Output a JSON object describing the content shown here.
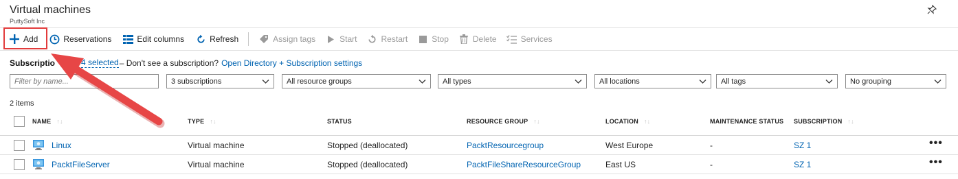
{
  "header": {
    "title": "Virtual machines",
    "subtitle": "PuttySoft Inc"
  },
  "toolbar": {
    "add": "Add",
    "reservations": "Reservations",
    "edit_columns": "Edit columns",
    "refresh": "Refresh",
    "assign_tags": "Assign tags",
    "start": "Start",
    "restart": "Restart",
    "stop": "Stop",
    "delete": "Delete",
    "services": "Services"
  },
  "subscription_line": {
    "label": "Subscriptio",
    "selected": "4 selected",
    "text": " – Don't see a subscription?",
    "link": "Open Directory + Subscription settings"
  },
  "filters": {
    "name_placeholder": "Filter by name...",
    "subscriptions": "3 subscriptions",
    "resource_groups": "All resource groups",
    "types": "All types",
    "locations": "All locations",
    "tags": "All tags",
    "grouping": "No grouping"
  },
  "items_count": "2 items",
  "columns": {
    "name": "NAME",
    "type": "TYPE",
    "status": "STATUS",
    "resource_group": "RESOURCE GROUP",
    "location": "LOCATION",
    "maintenance": "MAINTENANCE STATUS",
    "subscription": "SUBSCRIPTION"
  },
  "rows": [
    {
      "name": "Linux",
      "type": "Virtual machine",
      "status": "Stopped (deallocated)",
      "resource_group": "PacktResourcegroup",
      "location": "West Europe",
      "maintenance": "-",
      "subscription": "SZ 1",
      "more": "•••"
    },
    {
      "name": "PacktFileServer",
      "type": "Virtual machine",
      "status": "Stopped (deallocated)",
      "resource_group": "PacktFileShareResourceGroup",
      "location": "East US",
      "maintenance": "-",
      "subscription": "SZ 1",
      "more": "•••"
    }
  ],
  "colors": {
    "link": "#0063b1",
    "highlight": "#e23b3b",
    "disabled": "#9a9a9a"
  }
}
